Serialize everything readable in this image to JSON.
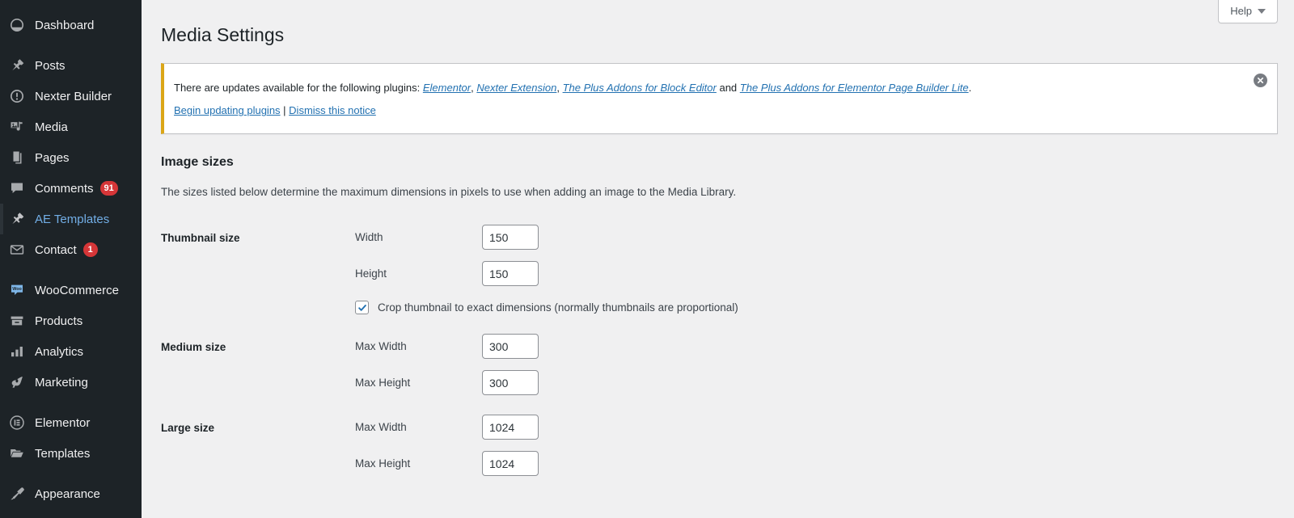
{
  "sidebar": {
    "items": [
      {
        "label": "Dashboard",
        "icon": "dashboard-icon",
        "state": "normal"
      },
      {
        "label": "Posts",
        "icon": "pin-icon",
        "state": "normal",
        "gap_before": true
      },
      {
        "label": "Nexter Builder",
        "icon": "exclamation-circle-icon",
        "state": "normal"
      },
      {
        "label": "Media",
        "icon": "media-icon",
        "state": "normal"
      },
      {
        "label": "Pages",
        "icon": "pages-icon",
        "state": "normal"
      },
      {
        "label": "Comments",
        "icon": "comment-icon",
        "state": "normal",
        "badge": "91"
      },
      {
        "label": "AE Templates",
        "icon": "pin-icon",
        "state": "active"
      },
      {
        "label": "Contact",
        "icon": "envelope-icon",
        "state": "normal",
        "badge": "1"
      },
      {
        "label": "WooCommerce",
        "icon": "woocommerce-icon",
        "state": "normal",
        "gap_before": true
      },
      {
        "label": "Products",
        "icon": "products-icon",
        "state": "normal"
      },
      {
        "label": "Analytics",
        "icon": "analytics-icon",
        "state": "normal"
      },
      {
        "label": "Marketing",
        "icon": "megaphone-icon",
        "state": "normal"
      },
      {
        "label": "Elementor",
        "icon": "elementor-icon",
        "state": "normal",
        "gap_before": true
      },
      {
        "label": "Templates",
        "icon": "folder-icon",
        "state": "normal"
      },
      {
        "label": "Appearance",
        "icon": "brush-icon",
        "state": "normal",
        "gap_before": true
      }
    ]
  },
  "screen_meta": {
    "help_label": "Help"
  },
  "header": {
    "page_title": "Media Settings"
  },
  "notice": {
    "intro_text": "There are updates available for the following plugins: ",
    "plugins": [
      {
        "name": "Elementor",
        "after": ", "
      },
      {
        "name": "Nexter Extension",
        "after": ", "
      },
      {
        "name": "The Plus Addons for Block Editor",
        "after": " and "
      },
      {
        "name": "The Plus Addons for Elementor Page Builder Lite",
        "after": "."
      }
    ],
    "begin_updating_label": "Begin updating plugins",
    "separator": " | ",
    "dismiss_label": "Dismiss this notice",
    "dismiss_icon_title": "Dismiss this notice",
    "accent_color": "#dba617",
    "link_color": "#2271b1"
  },
  "image_sizes": {
    "section_title": "Image sizes",
    "section_description": "The sizes listed below determine the maximum dimensions in pixels to use when adding an image to the Media Library.",
    "rows": [
      {
        "heading": "Thumbnail size",
        "fields": [
          {
            "label": "Width",
            "value": "150"
          },
          {
            "label": "Height",
            "value": "150"
          }
        ],
        "checkbox": {
          "label": "Crop thumbnail to exact dimensions (normally thumbnails are proportional)",
          "checked": true
        }
      },
      {
        "heading": "Medium size",
        "fields": [
          {
            "label": "Max Width",
            "value": "300"
          },
          {
            "label": "Max Height",
            "value": "300"
          }
        ]
      },
      {
        "heading": "Large size",
        "fields": [
          {
            "label": "Max Width",
            "value": "1024"
          },
          {
            "label": "Max Height",
            "value": "1024"
          }
        ]
      }
    ]
  },
  "colors": {
    "sidebar_bg": "#1d2327",
    "content_bg": "#f0f0f1",
    "link": "#2271b1",
    "active_menu": "#72aee6",
    "badge": "#d63638",
    "notice_border": "#dba617"
  }
}
